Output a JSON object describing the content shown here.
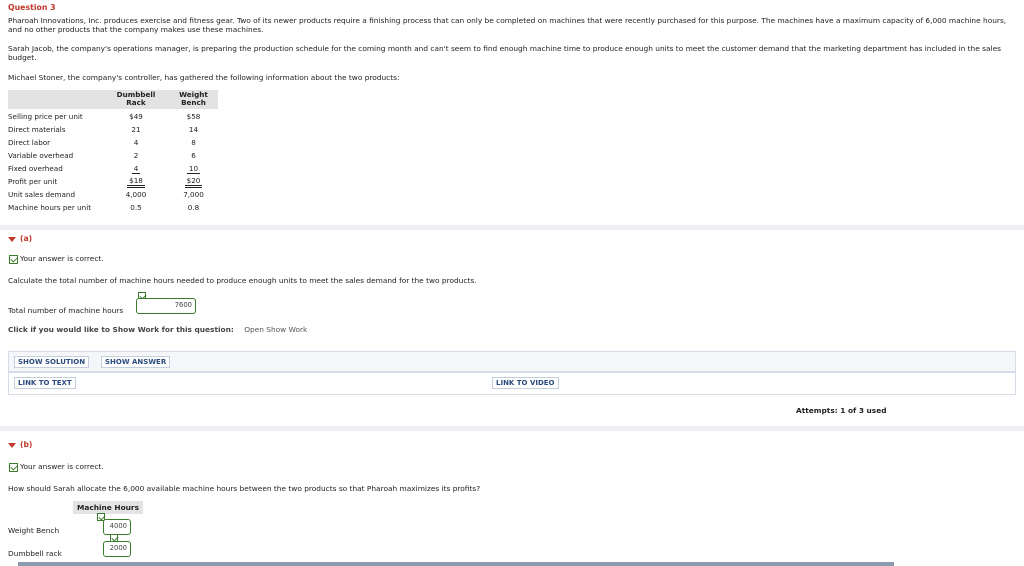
{
  "question": {
    "title": "Question 3",
    "intro": "Pharoah Innovations, Inc. produces exercise and fitness gear. Two of its newer products require a finishing process that can only be completed on machines that were recently purchased for this purpose. The machines have a maximum capacity of 6,000 machine hours, and no other products that the company makes use these machines.",
    "para2": "Sarah Jacob, the company's operations manager, is preparing the production schedule for the coming month and can't seem to find enough machine time to produce enough units to meet the customer demand that the marketing department has included in the sales budget.",
    "para3": "Michael Stoner, the company's controller, has gathered the following information about the two products:"
  },
  "product_table": {
    "headers": [
      "",
      "Dumbbell Rack",
      "Weight Bench"
    ],
    "header_lines": [
      [
        "Dumbbell",
        "Rack"
      ],
      [
        "Weight",
        "Bench"
      ]
    ],
    "rows": [
      {
        "label": "Selling price per unit",
        "a": "$49",
        "b": "$58"
      },
      {
        "label": "Direct materials",
        "a": "21",
        "b": "14"
      },
      {
        "label": "Direct labor",
        "a": "4",
        "b": "8"
      },
      {
        "label": "Variable overhead",
        "a": "2",
        "b": "6"
      },
      {
        "label": "Fixed overhead",
        "a": "4",
        "b": "10"
      },
      {
        "label": "Profit per unit",
        "a": "$18",
        "b": "$20"
      },
      {
        "label": "Unit sales demand",
        "a": "4,000",
        "b": "7,000"
      },
      {
        "label": "Machine hours per unit",
        "a": "0.5",
        "b": "0.8"
      }
    ]
  },
  "part_a": {
    "label": "(a)",
    "correct_msg": "Your answer is correct.",
    "prompt": "Calculate the total number of machine hours needed to produce enough units to meet the sales demand for the two products.",
    "field_label": "Total number of machine hours",
    "answer": "7600",
    "show_work_label": "Click if you would like to Show Work for this question:",
    "show_work_link": "Open Show Work",
    "show_solution": "SHOW SOLUTION",
    "show_answer": "SHOW ANSWER",
    "link_text": "LINK TO TEXT",
    "link_video": "LINK TO VIDEO",
    "attempts": "Attempts: 1 of 3 used"
  },
  "part_b": {
    "label": "(b)",
    "correct_msg": "Your answer is correct.",
    "prompt": "How should Sarah allocate the 6,000 available machine hours between the two products so that Pharoah maximizes its profits?",
    "col_header": "Machine Hours",
    "rows": [
      {
        "label": "Weight Bench",
        "value": "4000"
      },
      {
        "label": "Dumbbell rack",
        "value": "2000"
      }
    ]
  },
  "colors": {
    "accent_red": "#c0392b",
    "correct_green": "#3a7d2c",
    "link_blue": "#2b4c7e"
  }
}
